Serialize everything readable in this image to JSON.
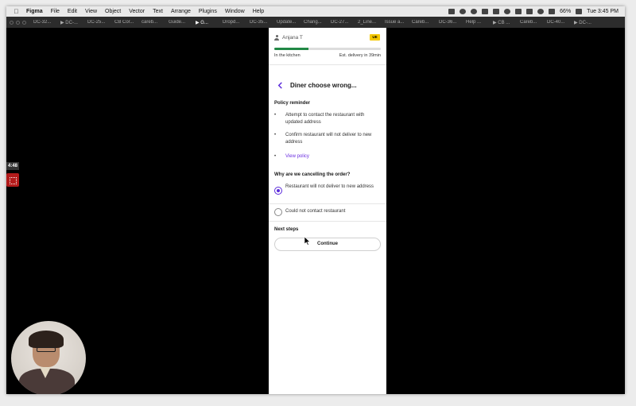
{
  "menubar": {
    "app_name": "Figma",
    "items": [
      "File",
      "Edit",
      "View",
      "Object",
      "Vector",
      "Text",
      "Arrange",
      "Plugins",
      "Window",
      "Help"
    ],
    "battery": "66%",
    "clock": "Tue 3:45 PM"
  },
  "tabs": [
    "DC-32...",
    "▶ DC-...",
    "DC-25...",
    "CB Cor...",
    "careb...",
    "Guide...",
    "▶ G...",
    "Dropd...",
    "DC-35...",
    "Update...",
    "Chang...",
    "DC-27...",
    "2_Line...",
    "Issue a...",
    "Careb...",
    "DC-36...",
    "Help ...",
    "▶ CB ...",
    "Careb...",
    "DC-40...",
    "▶ DC-..."
  ],
  "active_tab_index": 6,
  "recording": {
    "timer": "4:48"
  },
  "phone": {
    "agent_name": "Anjana T",
    "brand_badge": "UE",
    "order_progress": 0.32,
    "order_status": "In the kitchen",
    "eta": "Est. delivery in 39min",
    "page_title": "Diner choose wrong...",
    "policy_heading": "Policy reminder",
    "policy_items": [
      "Attempt to contact the restaurant with updated address",
      "Confirm restaurant will not deliver to new address"
    ],
    "policy_link": "View policy",
    "question": "Why are we cancelling the order?",
    "options": [
      {
        "label": "Restaurant will not deliver to new address",
        "selected": true
      },
      {
        "label": "Could not contact restaurant",
        "selected": false
      }
    ],
    "next_steps_heading": "Next steps",
    "continue_label": "Continue"
  },
  "colors": {
    "progress": "#218845",
    "accent": "#5b2bdb",
    "link": "#6b2ee0",
    "brand": "#f5c800"
  }
}
